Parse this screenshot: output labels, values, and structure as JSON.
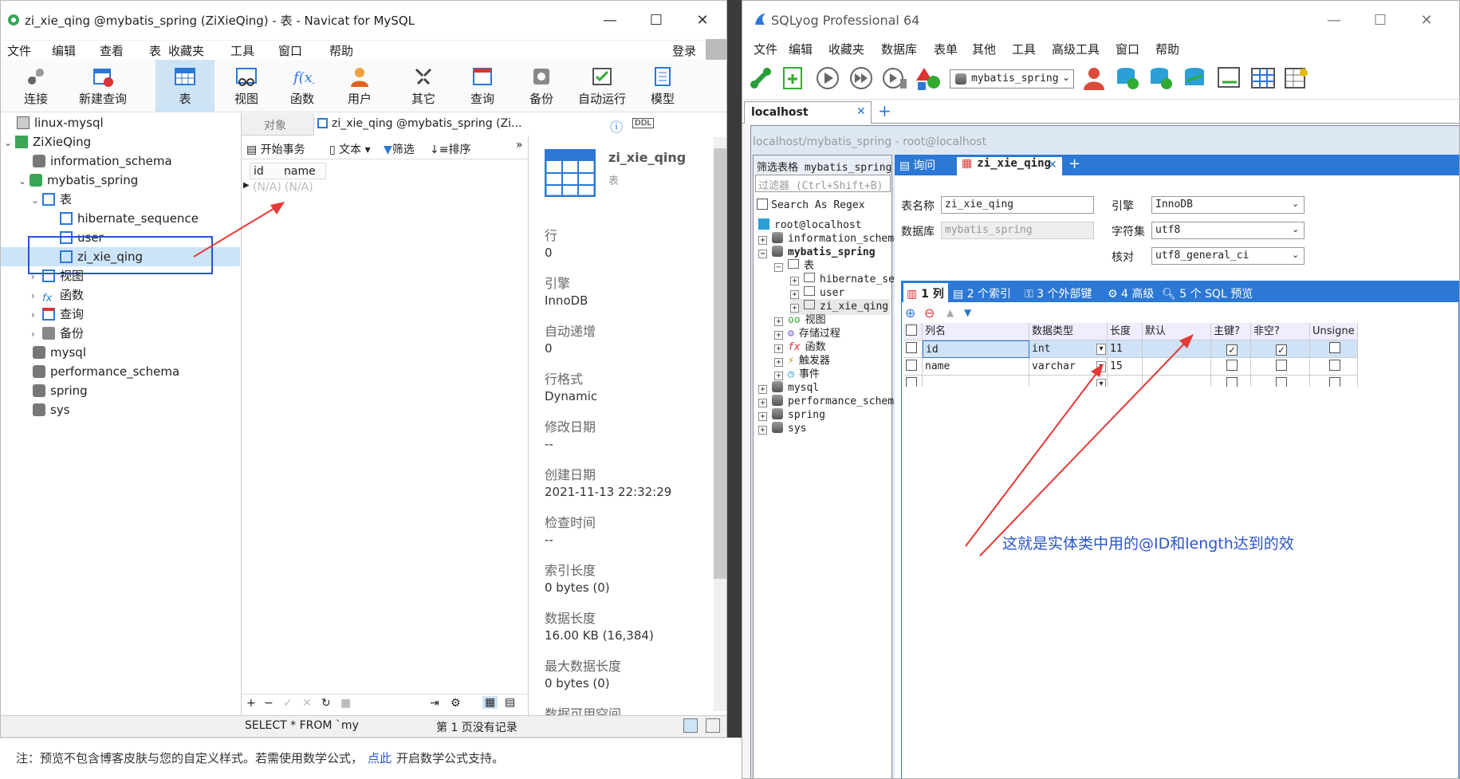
{
  "navicat": {
    "title": "zi_xie_qing @mybatis_spring (ZiXieQing) - 表 - Navicat for MySQL",
    "menu": [
      "文件",
      "编辑",
      "查看",
      "表",
      "收藏夹",
      "工具",
      "窗口",
      "帮助"
    ],
    "login": "登录",
    "toolbar": [
      "连接",
      "新建查询",
      "表",
      "视图",
      "函数",
      "用户",
      "其它",
      "查询",
      "备份",
      "自动运行",
      "模型"
    ],
    "tree": [
      {
        "label": "linux-mysql"
      },
      {
        "label": "ZiXieQing"
      },
      {
        "label": "information_schema"
      },
      {
        "label": "mybatis_spring"
      },
      {
        "label": "表"
      },
      {
        "label": "hibernate_sequence"
      },
      {
        "label": "user"
      },
      {
        "label": "zi_xie_qing"
      },
      {
        "label": "视图"
      },
      {
        "label": "函数"
      },
      {
        "label": "查询"
      },
      {
        "label": "备份"
      },
      {
        "label": "mysql"
      },
      {
        "label": "performance_schema"
      },
      {
        "label": "spring"
      },
      {
        "label": "sys"
      }
    ],
    "tabs": {
      "objects": "对象",
      "table": "zi_xie_qing @mybatis_spring (Zi..."
    },
    "subtoolbar": {
      "begin": "开始事务",
      "text": "文本",
      "filter": "筛选",
      "sort": "排序"
    },
    "grid": {
      "columns": [
        "id",
        "name"
      ],
      "row": [
        "(N/A)",
        "(N/A)"
      ]
    },
    "info": {
      "name": "zi_xie_qing",
      "type": "表",
      "rows_label": "行",
      "rows": "0",
      "engine_label": "引擎",
      "engine": "InnoDB",
      "auto_label": "自动递增",
      "auto": "0",
      "format_label": "行格式",
      "format": "Dynamic",
      "modified_label": "修改日期",
      "modified": "--",
      "created_label": "创建日期",
      "created": "2021-11-13 22:32:29",
      "check_label": "检查时间",
      "check": "--",
      "index_label": "索引长度",
      "index": "0 bytes (0)",
      "data_label": "数据长度",
      "data": "16.00 KB (16,384)",
      "maxdata_label": "最大数据长度",
      "maxdata": "0 bytes (0)",
      "free_label": "数据可用空间"
    },
    "status": {
      "sql": "SELECT * FROM `my",
      "page": "第 1 页没有记录"
    }
  },
  "note": {
    "prefix": "注：预览不包含博客皮肤与您的自定义样式。若需使用数学公式，",
    "link": "点此",
    "suffix": "开启数学公式支持。"
  },
  "sqlyog": {
    "title": "SQLyog Professional 64",
    "menu": [
      "文件",
      "编辑",
      "收藏夹",
      "数据库",
      "表单",
      "其他",
      "工具",
      "高级工具",
      "窗口",
      "帮助"
    ],
    "db_select": "mybatis_spring",
    "conn_tab": "localhost",
    "path": "localhost/mybatis_spring - root@localhost",
    "filter_title": "筛选表格 mybatis_spring",
    "filter_placeholder": "过滤器 (Ctrl+Shift+B)",
    "regex": "Search As Regex",
    "tree": [
      "root@localhost",
      "information_schema",
      "mybatis_spring",
      "表",
      "hibernate_sequ",
      "user",
      "zi_xie_qing",
      "视图",
      "存储过程",
      "函数",
      "触发器",
      "事件",
      "mysql",
      "performance_schema",
      "spring",
      "sys"
    ],
    "tabs": {
      "query": "询问",
      "table": "zi_xie_qing"
    },
    "form": {
      "name_label": "表名称",
      "name": "zi_xie_qing",
      "db_label": "数据库",
      "db": "mybatis_spring",
      "engine_label": "引擎",
      "engine": "InnoDB",
      "charset_label": "字符集",
      "charset": "utf8",
      "collation_label": "核对",
      "collation": "utf8_general_ci"
    },
    "subtabs": [
      "1 列",
      "2 个索引",
      "3 个外部键",
      "4 高级",
      "5 个 SQL 预览"
    ],
    "grid_headers": [
      "列名",
      "数据类型",
      "长度",
      "默认",
      "主键?",
      "非空?",
      "Unsigne"
    ],
    "rows": [
      {
        "name": "id",
        "type": "int",
        "len": "11",
        "pk": true,
        "nn": true
      },
      {
        "name": "name",
        "type": "varchar",
        "len": "15",
        "pk": false,
        "nn": false
      },
      {
        "name": "",
        "type": "",
        "len": "",
        "pk": false,
        "nn": false
      }
    ],
    "annotation": "这就是实体类中用的@ID和length达到的效"
  }
}
